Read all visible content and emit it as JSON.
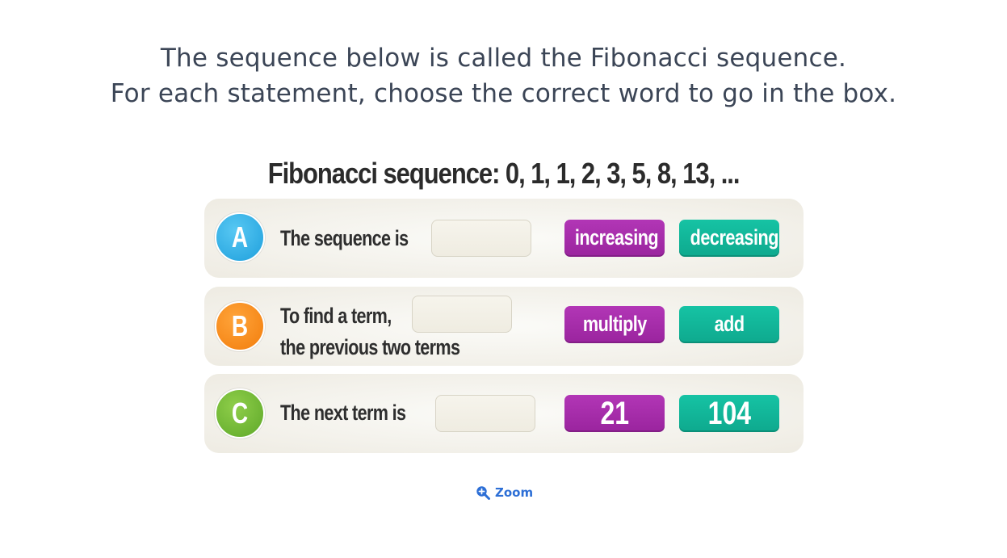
{
  "instructions": {
    "line1": "The sequence below is called the Fibonacci sequence.",
    "line2": "For each statement, choose the correct word to go in the box."
  },
  "sequence_title": "Fibonacci sequence: 0, 1, 1, 2, 3, 5, 8, 13, ...",
  "statements": [
    {
      "letter": "A",
      "text": "The sequence is",
      "options": [
        "increasing",
        "decreasing"
      ]
    },
    {
      "letter": "B",
      "text_line1": "To find a term,",
      "text_line2": "the previous two terms",
      "options": [
        "multiply",
        "add"
      ]
    },
    {
      "letter": "C",
      "text": "The next term is",
      "options": [
        "21",
        "104"
      ]
    }
  ],
  "zoom": {
    "label": "Zoom",
    "icon": "zoom-in-icon"
  },
  "colors": {
    "instructions_text": "#3b4556",
    "badge_a": "#29a9e1",
    "badge_b": "#f5880f",
    "badge_c": "#6bb431",
    "option_purple": "#a62caa",
    "option_teal": "#12b698",
    "zoom_link": "#2d6fd6"
  }
}
